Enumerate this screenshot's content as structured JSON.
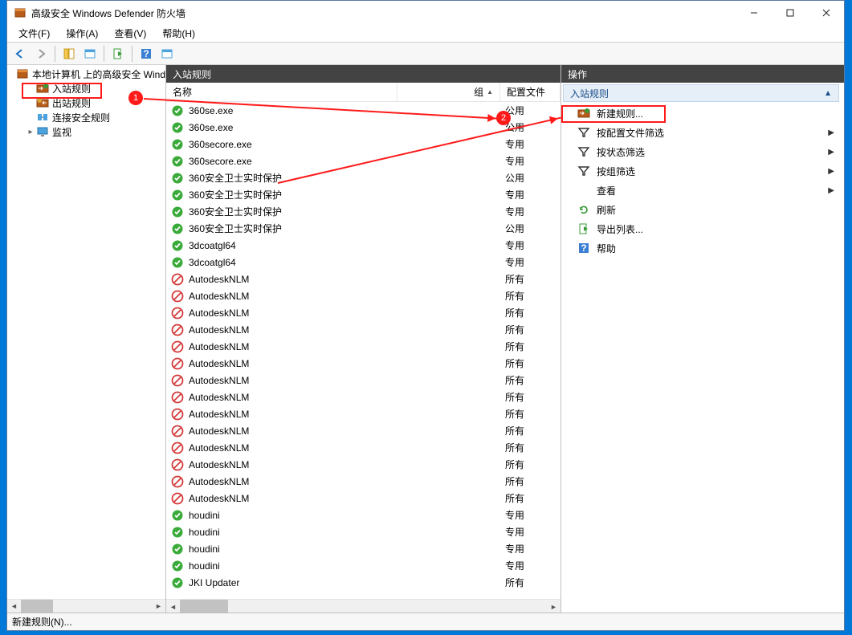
{
  "window": {
    "title": "高级安全 Windows Defender 防火墙"
  },
  "menubar": [
    {
      "id": "file",
      "label": "文件(F)"
    },
    {
      "id": "action",
      "label": "操作(A)"
    },
    {
      "id": "view",
      "label": "查看(V)"
    },
    {
      "id": "help",
      "label": "帮助(H)"
    }
  ],
  "tree": {
    "root_label": "本地计算机 上的高级安全 Wind",
    "items": [
      {
        "id": "inbound",
        "label": "入站规则",
        "icon": "inbound-icon",
        "highlight": true
      },
      {
        "id": "outbound",
        "label": "出站规则",
        "icon": "outbound-icon"
      },
      {
        "id": "connsec",
        "label": "连接安全规则",
        "icon": "connsec-icon"
      },
      {
        "id": "monitor",
        "label": "监视",
        "icon": "monitor-icon",
        "expandable": true
      }
    ]
  },
  "center": {
    "header": "入站规则",
    "columns": {
      "name": "名称",
      "group": "组",
      "profile": "配置文件"
    },
    "rules": [
      {
        "name": "360se.exe",
        "group": "",
        "profile": "公用",
        "allowed": true
      },
      {
        "name": "360se.exe",
        "group": "",
        "profile": "公用",
        "allowed": true
      },
      {
        "name": "360secore.exe",
        "group": "",
        "profile": "专用",
        "allowed": true
      },
      {
        "name": "360secore.exe",
        "group": "",
        "profile": "专用",
        "allowed": true
      },
      {
        "name": "360安全卫士实时保护",
        "group": "",
        "profile": "公用",
        "allowed": true
      },
      {
        "name": "360安全卫士实时保护",
        "group": "",
        "profile": "专用",
        "allowed": true
      },
      {
        "name": "360安全卫士实时保护",
        "group": "",
        "profile": "专用",
        "allowed": true
      },
      {
        "name": "360安全卫士实时保护",
        "group": "",
        "profile": "公用",
        "allowed": true
      },
      {
        "name": "3dcoatgl64",
        "group": "",
        "profile": "专用",
        "allowed": true
      },
      {
        "name": "3dcoatgl64",
        "group": "",
        "profile": "专用",
        "allowed": true
      },
      {
        "name": "AutodeskNLM",
        "group": "",
        "profile": "所有",
        "allowed": false
      },
      {
        "name": "AutodeskNLM",
        "group": "",
        "profile": "所有",
        "allowed": false
      },
      {
        "name": "AutodeskNLM",
        "group": "",
        "profile": "所有",
        "allowed": false
      },
      {
        "name": "AutodeskNLM",
        "group": "",
        "profile": "所有",
        "allowed": false
      },
      {
        "name": "AutodeskNLM",
        "group": "",
        "profile": "所有",
        "allowed": false
      },
      {
        "name": "AutodeskNLM",
        "group": "",
        "profile": "所有",
        "allowed": false
      },
      {
        "name": "AutodeskNLM",
        "group": "",
        "profile": "所有",
        "allowed": false
      },
      {
        "name": "AutodeskNLM",
        "group": "",
        "profile": "所有",
        "allowed": false
      },
      {
        "name": "AutodeskNLM",
        "group": "",
        "profile": "所有",
        "allowed": false
      },
      {
        "name": "AutodeskNLM",
        "group": "",
        "profile": "所有",
        "allowed": false
      },
      {
        "name": "AutodeskNLM",
        "group": "",
        "profile": "所有",
        "allowed": false
      },
      {
        "name": "AutodeskNLM",
        "group": "",
        "profile": "所有",
        "allowed": false
      },
      {
        "name": "AutodeskNLM",
        "group": "",
        "profile": "所有",
        "allowed": false
      },
      {
        "name": "AutodeskNLM",
        "group": "",
        "profile": "所有",
        "allowed": false
      },
      {
        "name": "houdini",
        "group": "",
        "profile": "专用",
        "allowed": true
      },
      {
        "name": "houdini",
        "group": "",
        "profile": "专用",
        "allowed": true
      },
      {
        "name": "houdini",
        "group": "",
        "profile": "专用",
        "allowed": true
      },
      {
        "name": "houdini",
        "group": "",
        "profile": "专用",
        "allowed": true
      },
      {
        "name": "JKI Updater",
        "group": "",
        "profile": "所有",
        "allowed": true
      }
    ]
  },
  "actions": {
    "header": "操作",
    "section_title": "入站规则",
    "items": [
      {
        "id": "new-rule",
        "label": "新建规则...",
        "icon": "inbound-icon",
        "highlight": true
      },
      {
        "id": "filter-profile",
        "label": "按配置文件筛选",
        "icon": "filter-icon",
        "submenu": true
      },
      {
        "id": "filter-state",
        "label": "按状态筛选",
        "icon": "filter-icon",
        "submenu": true
      },
      {
        "id": "filter-group",
        "label": "按组筛选",
        "icon": "filter-icon",
        "submenu": true
      },
      {
        "id": "view",
        "label": "查看",
        "icon": "",
        "submenu": true
      },
      {
        "id": "refresh",
        "label": "刷新",
        "icon": "refresh-icon"
      },
      {
        "id": "export-list",
        "label": "导出列表...",
        "icon": "export-icon"
      },
      {
        "id": "help",
        "label": "帮助",
        "icon": "help-icon"
      }
    ]
  },
  "statusbar": {
    "text": "新建规则(N)..."
  },
  "annotations": {
    "num1": "1",
    "num2": "2"
  }
}
